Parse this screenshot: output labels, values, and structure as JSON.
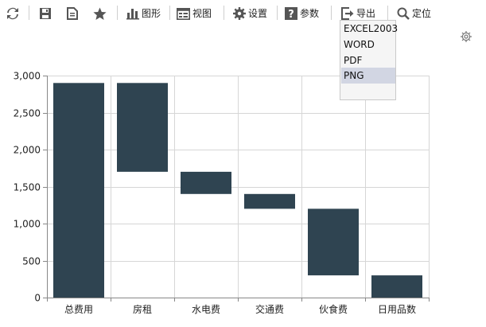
{
  "toolbar": {
    "graph_label": "图形",
    "view_label": "视图",
    "settings_label": "设置",
    "params_label": "参数",
    "export_label": "导出",
    "locate_label": "定位"
  },
  "export_menu": {
    "items": [
      "EXCEL2003",
      "WORD",
      "PDF",
      "PNG"
    ],
    "selected": "PNG"
  },
  "colors": {
    "bar": "#2f4451",
    "grid": "#d6d6d6",
    "axis": "#888888",
    "selected_bg": "#d2d6e3"
  },
  "chart_data": {
    "type": "bar",
    "subtype": "waterfall",
    "categories": [
      "总费用",
      "房租",
      "水电费",
      "交通费",
      "伙食费",
      "日用品数"
    ],
    "series": [
      {
        "values": [
          {
            "low": 0,
            "high": 2900
          },
          {
            "low": 1700,
            "high": 2900
          },
          {
            "low": 1400,
            "high": 1700
          },
          {
            "low": 1200,
            "high": 1400
          },
          {
            "low": 300,
            "high": 1200
          },
          {
            "low": 0,
            "high": 300
          }
        ]
      }
    ],
    "title": "",
    "xlabel": "",
    "ylabel": "",
    "ylim": [
      0,
      3000
    ],
    "yticks": [
      0,
      500,
      1000,
      1500,
      2000,
      2500,
      3000
    ],
    "ytick_labels": [
      "0",
      "500",
      "1,000",
      "1,500",
      "2,000",
      "2,500",
      "3,000"
    ],
    "grid": true,
    "legend": "none"
  }
}
